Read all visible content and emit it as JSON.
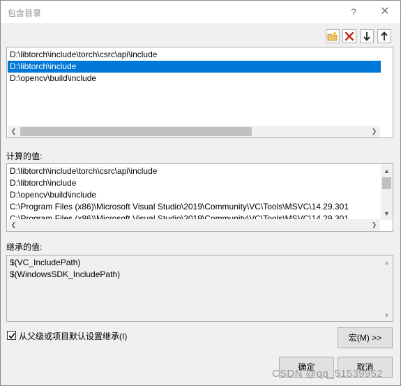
{
  "window": {
    "title": "包含目录",
    "help_label": "?",
    "close_label": "✕"
  },
  "toolbar": {
    "new_line_icon": "new-folder-icon",
    "delete_icon": "delete-icon",
    "move_down_icon": "arrow-down-icon",
    "move_up_icon": "arrow-up-icon",
    "delete_color": "#c42b1c"
  },
  "edit_list": {
    "items": [
      "D:\\libtorch\\include\\torch\\csrc\\api\\include",
      "D:\\libtorch\\include",
      "D:\\opencv\\build\\include"
    ],
    "selected_index": 1,
    "selection_color": "#0078d7"
  },
  "evaluated": {
    "label": "计算的值:",
    "items": [
      "D:\\libtorch\\include\\torch\\csrc\\api\\include",
      "D:\\libtorch\\include",
      "D:\\opencv\\build\\include",
      "C:\\Program Files (x86)\\Microsoft Visual Studio\\2019\\Community\\VC\\Tools\\MSVC\\14.29.301",
      "C:\\Program Files (x86)\\Microsoft Visual Studio\\2019\\Community\\VC\\Tools\\MSVC\\14.29.301"
    ]
  },
  "inherited": {
    "label": "继承的值:",
    "items": [
      "$(VC_IncludePath)",
      "$(WindowsSDK_IncludePath)"
    ]
  },
  "inherit_checkbox": {
    "label": "从父级或项目默认设置继承(I)",
    "checked": true
  },
  "buttons": {
    "macros": "宏(M) >>",
    "ok": "确定",
    "cancel": "取消"
  },
  "watermark": "CSDN @qq_51539952"
}
